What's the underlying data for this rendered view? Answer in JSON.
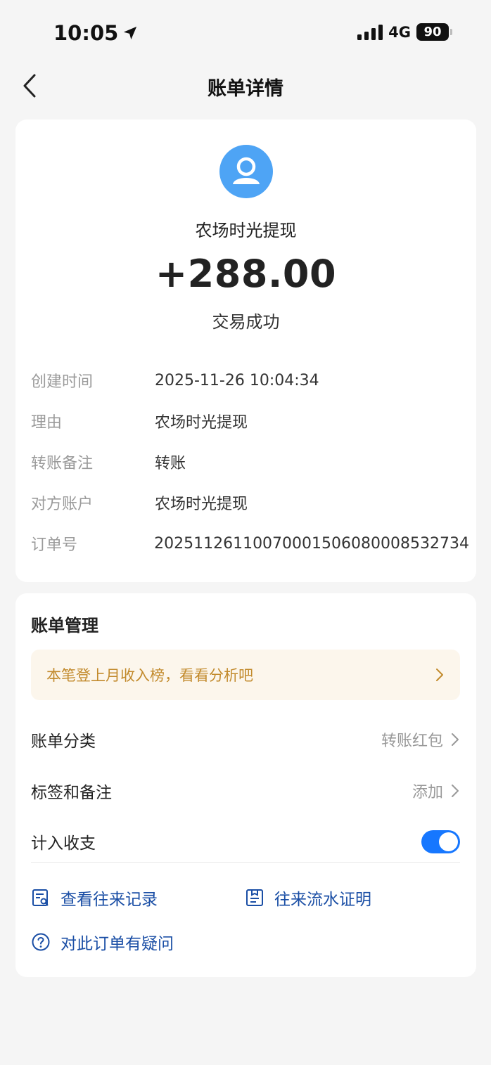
{
  "status_bar": {
    "time": "10:05",
    "network": "4G",
    "battery": "90"
  },
  "nav": {
    "title": "账单详情"
  },
  "transaction": {
    "payee": "农场时光提现",
    "amount": "+288.00",
    "status": "交易成功",
    "details": [
      {
        "label": "创建时间",
        "value": "2025-11-26 10:04:34"
      },
      {
        "label": "理由",
        "value": "农场时光提现"
      },
      {
        "label": "转账备注",
        "value": "转账"
      },
      {
        "label": "对方账户",
        "value": "农场时光提现"
      },
      {
        "label": "订单号",
        "value": "2025112611007000150608000853273​4"
      }
    ]
  },
  "management": {
    "title": "账单管理",
    "promo": "本笔登上月收入榜，看看分析吧",
    "category_label": "账单分类",
    "category_value": "转账红包",
    "tags_label": "标签和备注",
    "tags_value": "添加",
    "income_label": "计入收支",
    "income_enabled": true,
    "link_records": "查看往来记录",
    "link_proof": "往来流水证明",
    "link_question": "对此订单有疑问"
  },
  "colors": {
    "accent": "#1677ff",
    "link": "#1a4ea5",
    "promo_text": "#c28a2c",
    "avatar": "#4ea4f5"
  }
}
